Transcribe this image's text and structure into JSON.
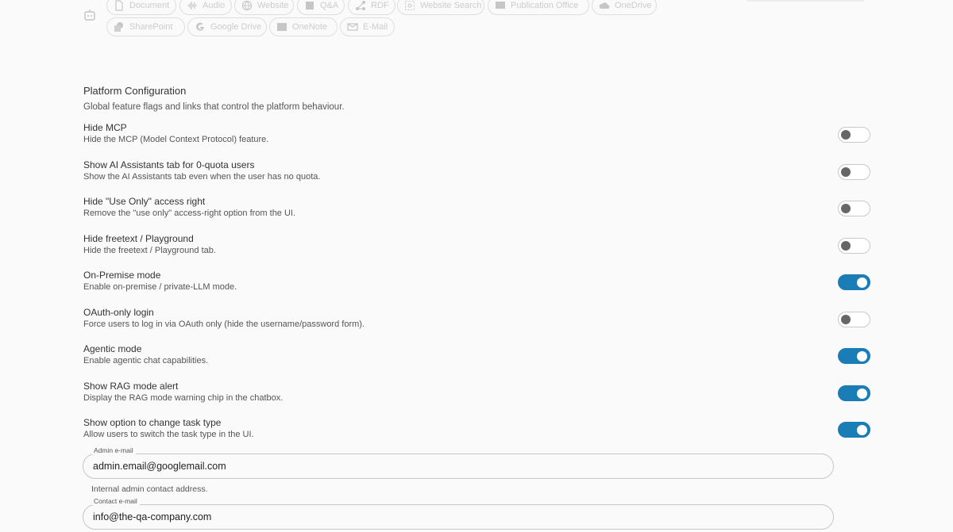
{
  "chips": {
    "row1": [
      {
        "label": "Document",
        "icon": "document-icon"
      },
      {
        "label": "Audio",
        "icon": "audio-waveform-icon"
      },
      {
        "label": "Website",
        "icon": "globe-icon"
      },
      {
        "label": "Q&A",
        "icon": "book-icon"
      },
      {
        "label": "RDF",
        "icon": "graph-icon"
      },
      {
        "label": "Website Search",
        "icon": "web-search-icon"
      },
      {
        "label": "Publication Office",
        "icon": "publication-office-icon"
      },
      {
        "label": "OneDrive",
        "icon": "cloud-icon"
      }
    ],
    "row2": [
      {
        "label": "SharePoint",
        "icon": "sharepoint-icon"
      },
      {
        "label": "Google Drive",
        "icon": "google-icon"
      },
      {
        "label": "OneNote",
        "icon": "onenote-icon"
      },
      {
        "label": "E-Mail",
        "icon": "mail-icon"
      }
    ]
  },
  "platform": {
    "title": "Platform Configuration",
    "description": "Global feature flags and links that control the platform behaviour.",
    "settings": [
      {
        "title": "Hide MCP",
        "description": "Hide the MCP (Model Context Protocol) feature.",
        "enabled": false
      },
      {
        "title": "Show AI Assistants tab for 0-quota users",
        "description": "Show the AI Assistants tab even when the user has no quota.",
        "enabled": false
      },
      {
        "title": "Hide \"Use Only\" access right",
        "description": "Remove the \"use only\" access-right option from the UI.",
        "enabled": false
      },
      {
        "title": "Hide freetext / Playground",
        "description": "Hide the freetext / Playground tab.",
        "enabled": false
      },
      {
        "title": "On-Premise mode",
        "description": "Enable on-premise / private-LLM mode.",
        "enabled": true
      },
      {
        "title": "OAuth-only login",
        "description": "Force users to log in via OAuth only (hide the username/password form).",
        "enabled": false
      },
      {
        "title": "Agentic mode",
        "description": "Enable agentic chat capabilities.",
        "enabled": true
      },
      {
        "title": "Show RAG mode alert",
        "description": "Display the RAG mode warning chip in the chatbox.",
        "enabled": true
      },
      {
        "title": "Show option to change task type",
        "description": "Allow users to switch the task type in the UI.",
        "enabled": true
      }
    ],
    "admin_email": {
      "label": "Admin e-mail",
      "value": "admin.email@googlemail.com",
      "helper": "Internal admin contact address."
    },
    "contact_email": {
      "label": "Contact e-mail",
      "value": "info@the-qa-company.com"
    }
  },
  "colors": {
    "toggle_on": "#1a7db5",
    "toggle_off_knob": "#666666"
  }
}
